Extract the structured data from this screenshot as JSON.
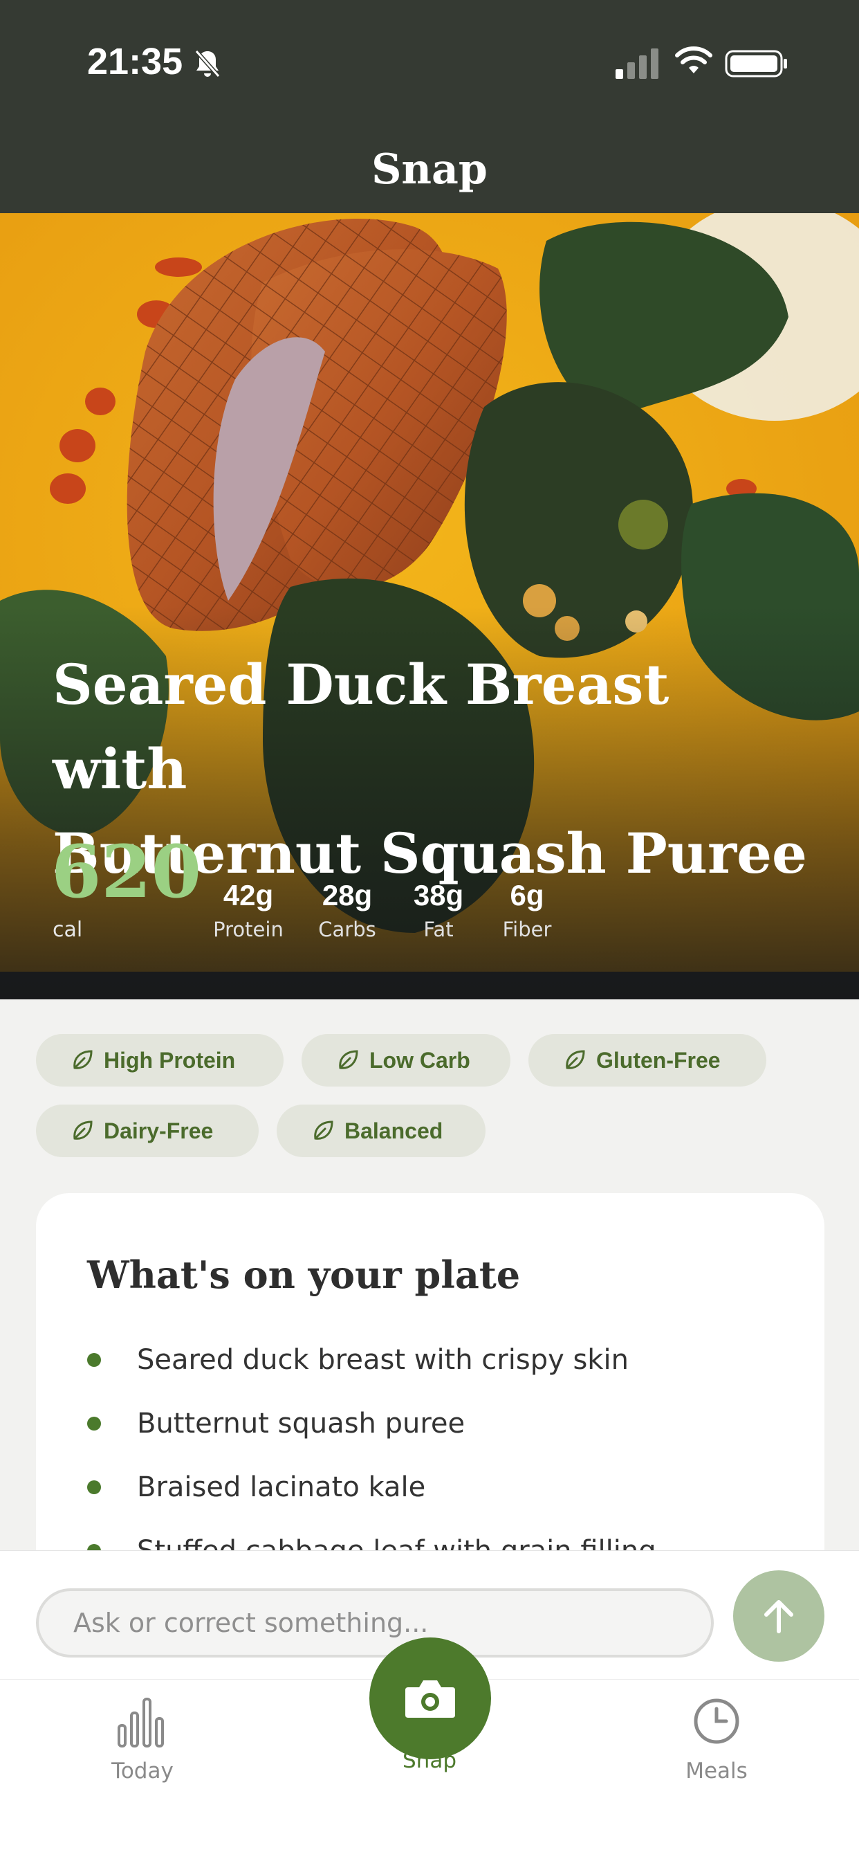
{
  "status_bar": {
    "time": "21:35"
  },
  "header": {
    "title": "Snap"
  },
  "dish": {
    "title_line1": "Seared Duck Breast with",
    "title_line2": "Butternut Squash Puree",
    "calories": "620",
    "calories_label": "cal",
    "macros": [
      {
        "value": "42g",
        "label": "Protein"
      },
      {
        "value": "28g",
        "label": "Carbs"
      },
      {
        "value": "38g",
        "label": "Fat"
      },
      {
        "value": "6g",
        "label": "Fiber"
      }
    ]
  },
  "tags": [
    "High Protein",
    "Low Carb",
    "Gluten-Free",
    "Dairy-Free",
    "Balanced"
  ],
  "plate": {
    "title": "What's on your plate",
    "items": [
      "Seared duck breast with crispy skin",
      "Butternut squash puree",
      "Braised lacinato kale",
      "Stuffed cabbage leaf with grain filling"
    ]
  },
  "ask": {
    "placeholder": "Ask or correct something..."
  },
  "tabs": [
    {
      "label": "Today",
      "icon": "bar-chart-icon"
    },
    {
      "label": "Snap",
      "icon": "camera-icon"
    },
    {
      "label": "Meals",
      "icon": "clock-icon"
    }
  ],
  "colors": {
    "accent": "#4d7a2c",
    "header_bg": "#353a33",
    "calorie": "#9bd083",
    "tag_bg": "#e3e5dc"
  }
}
